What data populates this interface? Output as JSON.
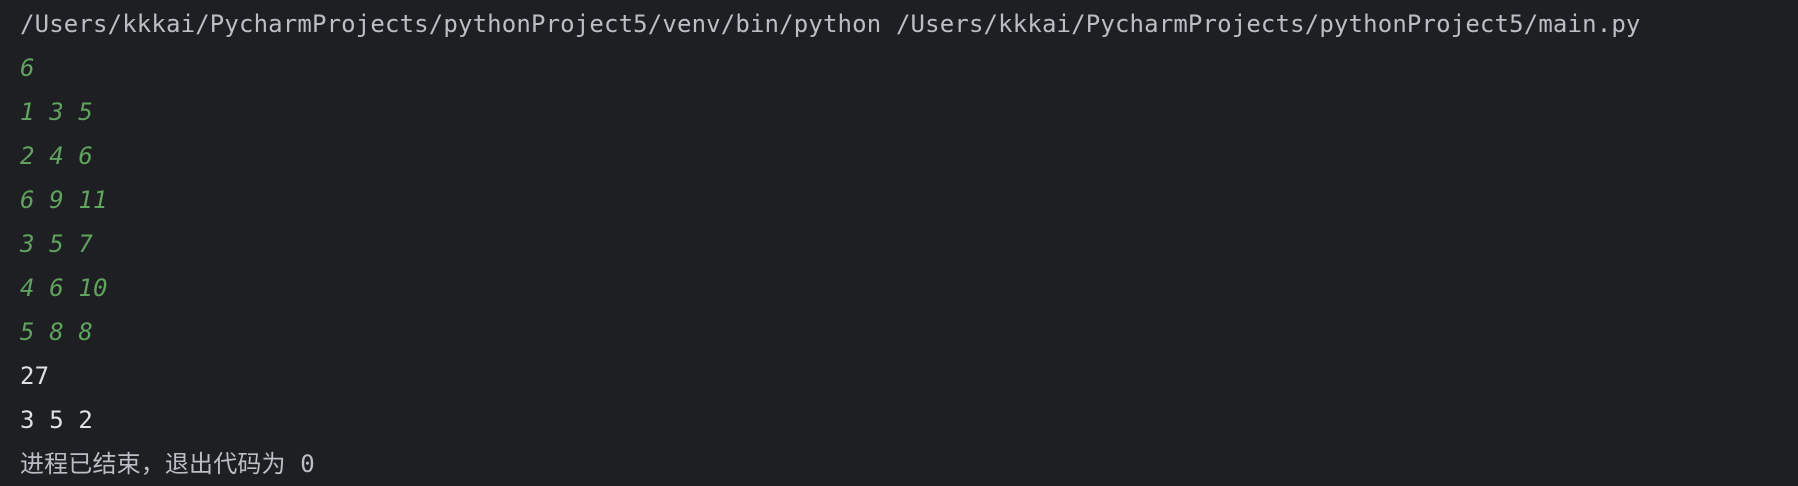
{
  "console": {
    "command": "/Users/kkkai/PycharmProjects/pythonProject5/venv/bin/python /Users/kkkai/PycharmProjects/pythonProject5/main.py",
    "user_input_lines": [
      "6",
      "1 3 5",
      "2 4 6",
      "6 9 11",
      "3 5 7",
      "4 6 10",
      "5 8 8"
    ],
    "output_lines": [
      "27",
      "3 5 2"
    ],
    "exit_message": "进程已结束，退出代码为 0"
  },
  "colors": {
    "background": "#1e1f22",
    "command_text": "#bcbec4",
    "user_input_text": "#5fa35f",
    "program_output_text": "#dfe1e5"
  }
}
